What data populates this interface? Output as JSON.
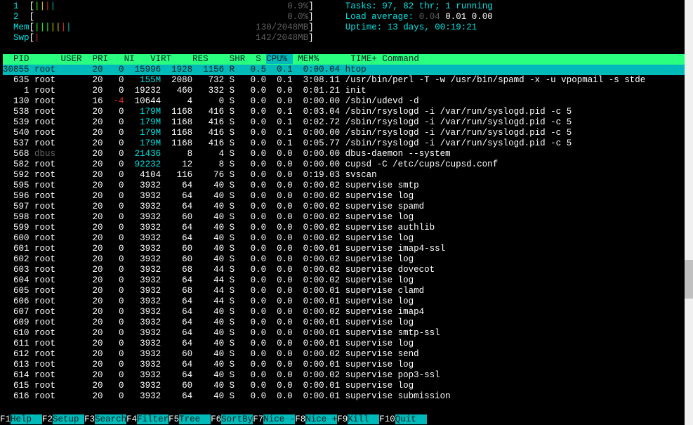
{
  "meters": {
    "cpu1": {
      "label": "1",
      "bar": "||||",
      "barColors": [
        "#2aff2a",
        "#d8d800",
        "#d83030",
        "#00b9b9"
      ],
      "pct": "0.9%"
    },
    "cpu2": {
      "label": "2",
      "bar": "",
      "barColors": [],
      "pct": "0.0%"
    },
    "mem": {
      "label": "Mem",
      "bar": "|||||||",
      "barColors": [
        "#2aff2a",
        "#2aff2a",
        "#2aff2a",
        "#d8d800",
        "#d8d800",
        "#d83030",
        "#00b9b9"
      ],
      "pct": "130/2048MB"
    },
    "swp": {
      "label": "Swp",
      "bar": "|",
      "barColors": [
        "#d83030"
      ],
      "pct": "142/2048MB"
    }
  },
  "summary": {
    "tasks": "Tasks: 97, 82 thr; 1 running",
    "load_label": "Load average:",
    "load1": "0.04",
    "load_rest": "0.01 0.00",
    "uptime": "Uptime: 13 days, 00:19:21"
  },
  "columns": [
    "  PID",
    "USER     ",
    "PRI",
    " NI",
    " VIRT",
    "  RES",
    "  SHR",
    "S",
    "CPU%",
    "MEM%",
    "  TIME+ ",
    "Command"
  ],
  "sort_col_index": 8,
  "selected_pid": 30855,
  "processes": [
    {
      "pid": 30855,
      "user": "root",
      "pri": "20",
      "ni": "0",
      "virt": "15996",
      "res": "1928",
      "shr": "1156",
      "s": "R",
      "cpu": "0.5",
      "mem": "0.1",
      "time": "0:00.04",
      "cmd": "htop"
    },
    {
      "pid": 635,
      "user": "root",
      "pri": "20",
      "ni": "0",
      "virt": "155M",
      "res": "2080",
      "shr": "732",
      "s": "S",
      "cpu": "0.0",
      "mem": "0.1",
      "time": "3:08.11",
      "cmd": "/usr/bin/perl -T -w /usr/bin/spamd -x -u vpopmail -s stde"
    },
    {
      "pid": 1,
      "user": "root",
      "pri": "20",
      "ni": "0",
      "virt": "19232",
      "res": "460",
      "shr": "332",
      "s": "S",
      "cpu": "0.0",
      "mem": "0.0",
      "time": "0:01.21",
      "cmd": "init"
    },
    {
      "pid": 130,
      "user": "root",
      "pri": "16",
      "ni": "-4",
      "virt": "10644",
      "res": "4",
      "shr": "0",
      "s": "S",
      "cpu": "0.0",
      "mem": "0.0",
      "time": "0:00.00",
      "cmd": "/sbin/udevd -d"
    },
    {
      "pid": 538,
      "user": "root",
      "pri": "20",
      "ni": "0",
      "virt": "179M",
      "res": "1168",
      "shr": "416",
      "s": "S",
      "cpu": "0.0",
      "mem": "0.1",
      "time": "0:03.04",
      "cmd": "/sbin/rsyslogd -i /var/run/syslogd.pid -c 5"
    },
    {
      "pid": 539,
      "user": "root",
      "pri": "20",
      "ni": "0",
      "virt": "179M",
      "res": "1168",
      "shr": "416",
      "s": "S",
      "cpu": "0.0",
      "mem": "0.1",
      "time": "0:02.72",
      "cmd": "/sbin/rsyslogd -i /var/run/syslogd.pid -c 5"
    },
    {
      "pid": 540,
      "user": "root",
      "pri": "20",
      "ni": "0",
      "virt": "179M",
      "res": "1168",
      "shr": "416",
      "s": "S",
      "cpu": "0.0",
      "mem": "0.1",
      "time": "0:00.00",
      "cmd": "/sbin/rsyslogd -i /var/run/syslogd.pid -c 5"
    },
    {
      "pid": 537,
      "user": "root",
      "pri": "20",
      "ni": "0",
      "virt": "179M",
      "res": "1168",
      "shr": "416",
      "s": "S",
      "cpu": "0.0",
      "mem": "0.1",
      "time": "0:05.77",
      "cmd": "/sbin/rsyslogd -i /var/run/syslogd.pid -c 5"
    },
    {
      "pid": 568,
      "user": "dbus",
      "pri": "20",
      "ni": "0",
      "virt": "21436",
      "res": "8",
      "shr": "4",
      "s": "S",
      "cpu": "0.0",
      "mem": "0.0",
      "time": "0:00.00",
      "cmd": "dbus-daemon --system"
    },
    {
      "pid": 582,
      "user": "root",
      "pri": "20",
      "ni": "0",
      "virt": "92232",
      "res": "12",
      "shr": "8",
      "s": "S",
      "cpu": "0.0",
      "mem": "0.0",
      "time": "0:00.00",
      "cmd": "cupsd -C /etc/cups/cupsd.conf"
    },
    {
      "pid": 592,
      "user": "root",
      "pri": "20",
      "ni": "0",
      "virt": "4104",
      "res": "116",
      "shr": "76",
      "s": "S",
      "cpu": "0.0",
      "mem": "0.0",
      "time": "0:19.03",
      "cmd": "svscan"
    },
    {
      "pid": 595,
      "user": "root",
      "pri": "20",
      "ni": "0",
      "virt": "3932",
      "res": "64",
      "shr": "40",
      "s": "S",
      "cpu": "0.0",
      "mem": "0.0",
      "time": "0:00.02",
      "cmd": "supervise smtp"
    },
    {
      "pid": 596,
      "user": "root",
      "pri": "20",
      "ni": "0",
      "virt": "3932",
      "res": "64",
      "shr": "40",
      "s": "S",
      "cpu": "0.0",
      "mem": "0.0",
      "time": "0:00.02",
      "cmd": "supervise log"
    },
    {
      "pid": 597,
      "user": "root",
      "pri": "20",
      "ni": "0",
      "virt": "3932",
      "res": "64",
      "shr": "40",
      "s": "S",
      "cpu": "0.0",
      "mem": "0.0",
      "time": "0:00.02",
      "cmd": "supervise spamd"
    },
    {
      "pid": 598,
      "user": "root",
      "pri": "20",
      "ni": "0",
      "virt": "3932",
      "res": "60",
      "shr": "40",
      "s": "S",
      "cpu": "0.0",
      "mem": "0.0",
      "time": "0:00.02",
      "cmd": "supervise log"
    },
    {
      "pid": 599,
      "user": "root",
      "pri": "20",
      "ni": "0",
      "virt": "3932",
      "res": "64",
      "shr": "40",
      "s": "S",
      "cpu": "0.0",
      "mem": "0.0",
      "time": "0:00.02",
      "cmd": "supervise authlib"
    },
    {
      "pid": 600,
      "user": "root",
      "pri": "20",
      "ni": "0",
      "virt": "3932",
      "res": "64",
      "shr": "40",
      "s": "S",
      "cpu": "0.0",
      "mem": "0.0",
      "time": "0:00.02",
      "cmd": "supervise log"
    },
    {
      "pid": 601,
      "user": "root",
      "pri": "20",
      "ni": "0",
      "virt": "3932",
      "res": "60",
      "shr": "40",
      "s": "S",
      "cpu": "0.0",
      "mem": "0.0",
      "time": "0:00.01",
      "cmd": "supervise imap4-ssl"
    },
    {
      "pid": 602,
      "user": "root",
      "pri": "20",
      "ni": "0",
      "virt": "3932",
      "res": "60",
      "shr": "40",
      "s": "S",
      "cpu": "0.0",
      "mem": "0.0",
      "time": "0:00.02",
      "cmd": "supervise log"
    },
    {
      "pid": 603,
      "user": "root",
      "pri": "20",
      "ni": "0",
      "virt": "3932",
      "res": "68",
      "shr": "44",
      "s": "S",
      "cpu": "0.0",
      "mem": "0.0",
      "time": "0:00.02",
      "cmd": "supervise dovecot"
    },
    {
      "pid": 604,
      "user": "root",
      "pri": "20",
      "ni": "0",
      "virt": "3932",
      "res": "64",
      "shr": "44",
      "s": "S",
      "cpu": "0.0",
      "mem": "0.0",
      "time": "0:00.02",
      "cmd": "supervise log"
    },
    {
      "pid": 605,
      "user": "root",
      "pri": "20",
      "ni": "0",
      "virt": "3932",
      "res": "68",
      "shr": "44",
      "s": "S",
      "cpu": "0.0",
      "mem": "0.0",
      "time": "0:00.01",
      "cmd": "supervise clamd"
    },
    {
      "pid": 606,
      "user": "root",
      "pri": "20",
      "ni": "0",
      "virt": "3932",
      "res": "64",
      "shr": "44",
      "s": "S",
      "cpu": "0.0",
      "mem": "0.0",
      "time": "0:00.01",
      "cmd": "supervise log"
    },
    {
      "pid": 607,
      "user": "root",
      "pri": "20",
      "ni": "0",
      "virt": "3932",
      "res": "64",
      "shr": "40",
      "s": "S",
      "cpu": "0.0",
      "mem": "0.0",
      "time": "0:00.02",
      "cmd": "supervise imap4"
    },
    {
      "pid": 609,
      "user": "root",
      "pri": "20",
      "ni": "0",
      "virt": "3932",
      "res": "64",
      "shr": "40",
      "s": "S",
      "cpu": "0.0",
      "mem": "0.0",
      "time": "0:00.01",
      "cmd": "supervise log"
    },
    {
      "pid": 610,
      "user": "root",
      "pri": "20",
      "ni": "0",
      "virt": "3932",
      "res": "64",
      "shr": "40",
      "s": "S",
      "cpu": "0.0",
      "mem": "0.0",
      "time": "0:00.01",
      "cmd": "supervise smtp-ssl"
    },
    {
      "pid": 611,
      "user": "root",
      "pri": "20",
      "ni": "0",
      "virt": "3932",
      "res": "64",
      "shr": "40",
      "s": "S",
      "cpu": "0.0",
      "mem": "0.0",
      "time": "0:00.01",
      "cmd": "supervise log"
    },
    {
      "pid": 612,
      "user": "root",
      "pri": "20",
      "ni": "0",
      "virt": "3932",
      "res": "60",
      "shr": "40",
      "s": "S",
      "cpu": "0.0",
      "mem": "0.0",
      "time": "0:00.02",
      "cmd": "supervise send"
    },
    {
      "pid": 613,
      "user": "root",
      "pri": "20",
      "ni": "0",
      "virt": "3932",
      "res": "64",
      "shr": "40",
      "s": "S",
      "cpu": "0.0",
      "mem": "0.0",
      "time": "0:00.01",
      "cmd": "supervise log"
    },
    {
      "pid": 614,
      "user": "root",
      "pri": "20",
      "ni": "0",
      "virt": "3932",
      "res": "64",
      "shr": "40",
      "s": "S",
      "cpu": "0.0",
      "mem": "0.0",
      "time": "0:00.02",
      "cmd": "supervise pop3-ssl"
    },
    {
      "pid": 615,
      "user": "root",
      "pri": "20",
      "ni": "0",
      "virt": "3932",
      "res": "60",
      "shr": "40",
      "s": "S",
      "cpu": "0.0",
      "mem": "0.0",
      "time": "0:00.01",
      "cmd": "supervise log"
    },
    {
      "pid": 616,
      "user": "root",
      "pri": "20",
      "ni": "0",
      "virt": "3932",
      "res": "64",
      "shr": "40",
      "s": "S",
      "cpu": "0.0",
      "mem": "0.0",
      "time": "0:00.01",
      "cmd": "supervise submission"
    }
  ],
  "footer": [
    {
      "key": "F1",
      "label": "Help  "
    },
    {
      "key": "F2",
      "label": "Setup "
    },
    {
      "key": "F3",
      "label": "Search"
    },
    {
      "key": "F4",
      "label": "Filter"
    },
    {
      "key": "F5",
      "label": "Tree  "
    },
    {
      "key": "F6",
      "label": "SortBy"
    },
    {
      "key": "F7",
      "label": "Nice -"
    },
    {
      "key": "F8",
      "label": "Nice +"
    },
    {
      "key": "F9",
      "label": "Kill  "
    },
    {
      "key": "F10",
      "label": "Quit  "
    }
  ]
}
